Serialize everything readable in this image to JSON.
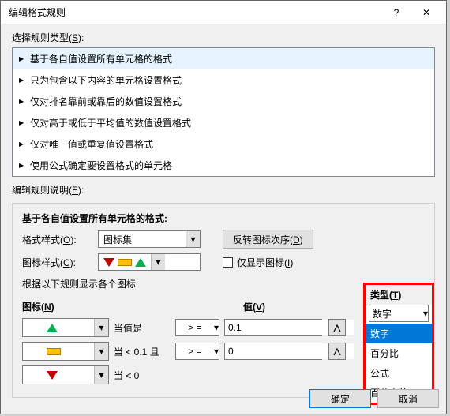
{
  "title": "编辑格式规则",
  "help_icon": "?",
  "close_icon": "✕",
  "select_rule_type": {
    "label": "选择规则类型(",
    "key": "S",
    "suffix": "):"
  },
  "rules": [
    "基于各自值设置所有单元格的格式",
    "只为包含以下内容的单元格设置格式",
    "仅对排名靠前或靠后的数值设置格式",
    "仅对高于或低于平均值的数值设置格式",
    "仅对唯一值或重复值设置格式",
    "使用公式确定要设置格式的单元格"
  ],
  "edit_desc": {
    "label": "编辑规则说明(",
    "key": "E",
    "suffix": "):"
  },
  "desc_title": "基于各自值设置所有单元格的格式:",
  "format_style": {
    "label": "格式样式(",
    "key": "O",
    "suffix": "):",
    "value": "图标集"
  },
  "reverse_btn": {
    "label": "反转图标次序(",
    "key": "D",
    "suffix": ")"
  },
  "icon_style": {
    "label": "图标样式(",
    "key": "C",
    "suffix": "):"
  },
  "show_icon_only": {
    "label": "仅显示图标(",
    "key": "I",
    "suffix": ")"
  },
  "rule_display": "根据以下规则显示各个图标:",
  "hdr_icon": {
    "label": "图标(",
    "key": "N",
    "suffix": ")"
  },
  "hdr_val": {
    "label": "值(",
    "key": "V",
    "suffix": ")"
  },
  "hdr_type": {
    "label": "类型(",
    "key": "T",
    "suffix": ")"
  },
  "rows": [
    {
      "cond": "当值是",
      "op": "> =",
      "val": "0.1"
    },
    {
      "cond": "当 < 0.1 且",
      "op": "> =",
      "val": "0"
    },
    {
      "cond": "当 < 0",
      "op": "",
      "val": ""
    }
  ],
  "type_sel": "数字",
  "type_opts": [
    "数字",
    "百分比",
    "公式",
    "百分点值"
  ],
  "ok": "确定",
  "cancel": "取消"
}
